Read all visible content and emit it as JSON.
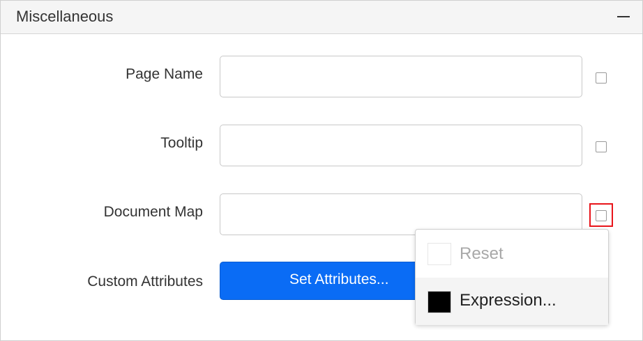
{
  "panel": {
    "title": "Miscellaneous",
    "collapse_icon": "minus-icon"
  },
  "rows": {
    "page_name": {
      "label": "Page Name",
      "value": "",
      "checkbox_checked": false
    },
    "tooltip": {
      "label": "Tooltip",
      "value": "",
      "checkbox_checked": false
    },
    "document_map": {
      "label": "Document Map",
      "value": "",
      "checkbox_checked": false,
      "highlighted": true
    },
    "custom_attributes": {
      "label": "Custom Attributes",
      "button_label": "Set Attributes..."
    }
  },
  "context_menu": {
    "items": [
      {
        "label": "Reset",
        "enabled": false,
        "swatch_color": "#ffffff"
      },
      {
        "label": "Expression...",
        "enabled": true,
        "swatch_color": "#000000"
      }
    ]
  },
  "colors": {
    "button": "#0a6cf5",
    "highlight": "#e8141a",
    "header_bg": "#f5f5f5"
  }
}
